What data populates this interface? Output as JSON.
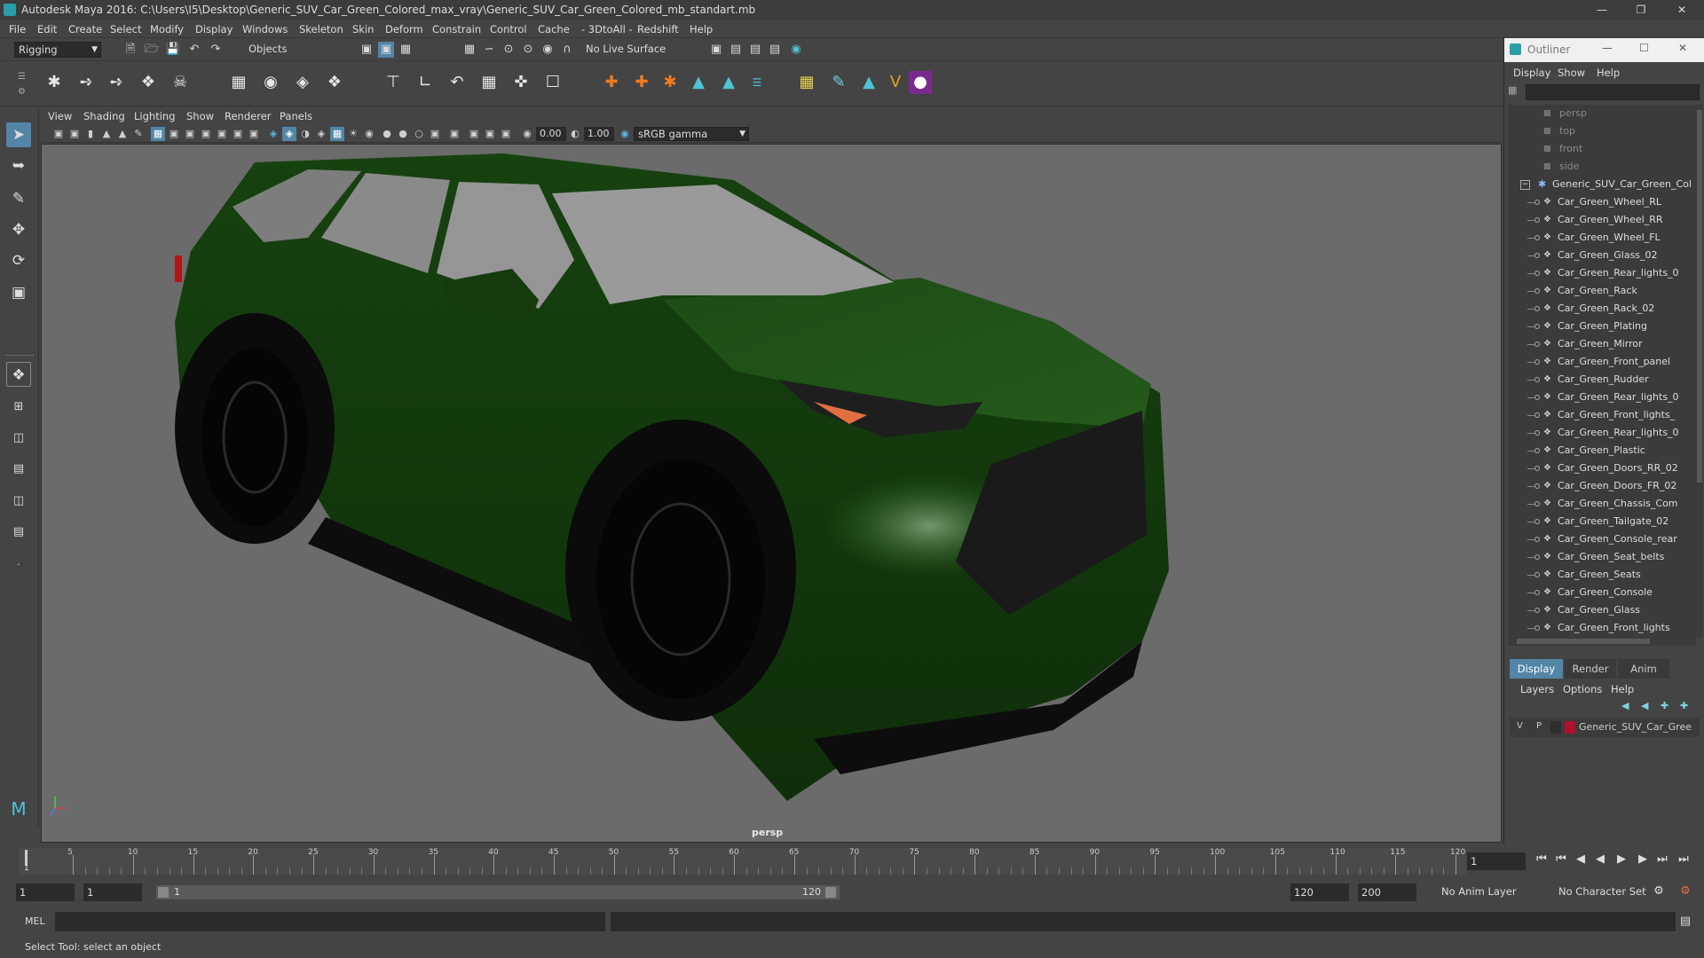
{
  "window": {
    "title": "Autodesk Maya 2016: C:\\Users\\I5\\Desktop\\Generic_SUV_Car_Green_Colored_max_vray\\Generic_SUV_Car_Green_Colored_mb_standart.mb"
  },
  "menubar": [
    "File",
    "Edit",
    "Create",
    "Select",
    "Modify",
    "Display",
    "Windows",
    "Skeleton",
    "Skin",
    "Deform",
    "Constrain",
    "Control",
    "Cache",
    "- 3DtoAll -",
    "Redshift",
    "Help"
  ],
  "statusline": {
    "menuset": "Rigging",
    "selection_mode": "Objects",
    "live_surface": "No Live Surface"
  },
  "panel": {
    "menus": [
      "View",
      "Shading",
      "Lighting",
      "Show",
      "Renderer",
      "Panels"
    ],
    "near_clip": "0.00",
    "far_clip": "1.00",
    "color_space": "sRGB gamma",
    "camera_label": "persp"
  },
  "outliner": {
    "title": "Outliner",
    "menus": [
      "Display",
      "Show",
      "Help"
    ],
    "cameras": [
      "persp",
      "top",
      "front",
      "side"
    ],
    "group": "Generic_SUV_Car_Green_Col",
    "items": [
      "Car_Green_Wheel_RL",
      "Car_Green_Wheel_RR",
      "Car_Green_Wheel_FL",
      "Car_Green_Glass_02",
      "Car_Green_Rear_lights_0",
      "Car_Green_Rack",
      "Car_Green_Rack_02",
      "Car_Green_Plating",
      "Car_Green_Mirror",
      "Car_Green_Front_panel",
      "Car_Green_Rudder",
      "Car_Green_Rear_lights_0",
      "Car_Green_Front_lights_",
      "Car_Green_Rear_lights_0",
      "Car_Green_Plastic",
      "Car_Green_Doors_RR_02",
      "Car_Green_Doors_FR_02",
      "Car_Green_Chassis_Com",
      "Car_Green_Tailgate_02",
      "Car_Green_Console_rear",
      "Car_Green_Seat_belts",
      "Car_Green_Seats",
      "Car_Green_Console",
      "Car_Green_Glass",
      "Car_Green_Front_lights"
    ]
  },
  "layers": {
    "tabs": [
      "Display",
      "Render",
      "Anim"
    ],
    "menus": [
      "Layers",
      "Options",
      "Help"
    ],
    "layer": {
      "v": "V",
      "p": "P",
      "name": "Generic_SUV_Car_Gree",
      "color": "#b0102a"
    }
  },
  "timeline": {
    "ticks": [
      "5",
      "10",
      "15",
      "20",
      "25",
      "30",
      "35",
      "40",
      "45",
      "50",
      "55",
      "60",
      "65",
      "70",
      "75",
      "80",
      "85",
      "90",
      "95",
      "100",
      "105",
      "110",
      "115",
      "120"
    ],
    "start_tick": "1",
    "current_frame": "1"
  },
  "range": {
    "start": "1",
    "playback_start": "1",
    "slider_start": "1",
    "slider_end": "120",
    "playback_end": "120",
    "end": "200",
    "anim_layer": "No Anim Layer",
    "char_set": "No Character Set"
  },
  "cmdline": {
    "label": "MEL"
  },
  "helpline": {
    "text": "Select Tool: select an object"
  },
  "colors": {
    "accent": "#5285a6",
    "car_body": "#1d4a14",
    "viewport_bg": "#6b6b6b"
  }
}
